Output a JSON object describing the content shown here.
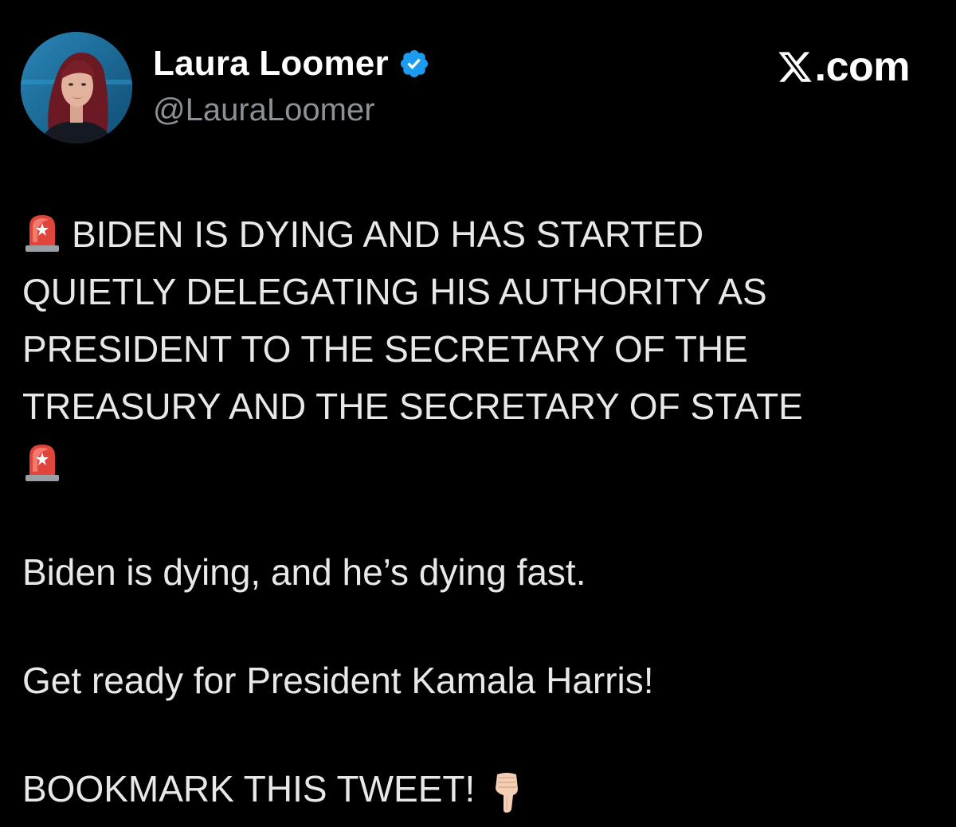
{
  "author": {
    "display_name": "Laura Loomer",
    "handle": "@LauraLoomer",
    "verified": true,
    "verified_badge_color": "#1d9bf0",
    "avatar_icon": "profile-photo"
  },
  "site_mark": {
    "label": ".com",
    "icon": "x-logo-icon"
  },
  "tweet": {
    "headline_lines": [
      "BIDEN IS DYING AND HAS STARTED",
      "QUIETLY DELEGATING HIS AUTHORITY AS",
      "PRESIDENT TO THE SECRETARY OF THE",
      "TREASURY AND THE SECRETARY OF STATE"
    ],
    "siren_emoji_icon": "rotating-light-icon",
    "paragraph_1": "Biden is dying, and he’s dying fast.",
    "paragraph_2": "Get ready for President Kamala Harris!",
    "paragraph_3": "BOOKMARK THIS TWEET!",
    "pointing_emoji_icon": "backhand-pointing-down-icon"
  },
  "colors": {
    "background": "#000000",
    "text": "#e7e9ea",
    "secondary_text": "#8b9197"
  }
}
